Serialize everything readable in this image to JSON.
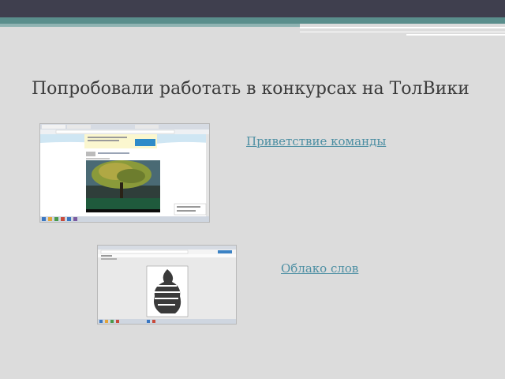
{
  "slide": {
    "title": "Попробовали работать в конкурсах на ТолВики"
  },
  "links": {
    "team_greeting": "Приветствие команды",
    "word_cloud": "Облако слов"
  },
  "colors": {
    "header_bar": "#3f3f4e",
    "accent_teal": "#5a8e8c",
    "background": "#dcdcdc",
    "title_text": "#3b3b3b",
    "link_text": "#4d8fa3"
  },
  "thumbnails": [
    {
      "name": "screenshot-team-greeting",
      "icon": "browser-window-icon"
    },
    {
      "name": "screenshot-word-cloud",
      "icon": "browser-window-icon"
    }
  ]
}
